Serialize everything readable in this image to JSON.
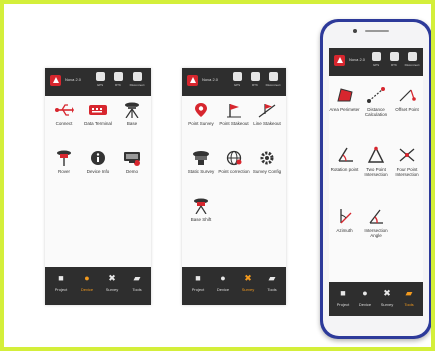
{
  "app": {
    "name": "Nova 2.0"
  },
  "topbar": {
    "icons": [
      {
        "name": "gps-status-icon",
        "label": "GPS"
      },
      {
        "name": "antenna-status-icon",
        "label": "RTK"
      },
      {
        "name": "disconnect-icon",
        "label": "Disconnect"
      }
    ]
  },
  "screens": {
    "project": {
      "items": [
        {
          "label": "Connect",
          "icon": "usb-icon"
        },
        {
          "label": "Data Terminal",
          "icon": "data-terminal-icon"
        },
        {
          "label": "Base",
          "icon": "base-station-icon"
        },
        {
          "label": "Rover",
          "icon": "rover-icon"
        },
        {
          "label": "Device Info",
          "icon": "info-icon"
        },
        {
          "label": "Demo",
          "icon": "demo-icon"
        }
      ],
      "active_tab": "Device"
    },
    "survey": {
      "items": [
        {
          "label": "Point Survey",
          "icon": "point-survey-icon"
        },
        {
          "label": "Point Stakeout",
          "icon": "point-stakeout-icon"
        },
        {
          "label": "Line Stakeout",
          "icon": "line-stakeout-icon"
        },
        {
          "label": "Static Survey",
          "icon": "static-survey-icon"
        },
        {
          "label": "Point correction",
          "icon": "point-correction-icon"
        },
        {
          "label": "Survey Config",
          "icon": "survey-config-icon"
        },
        {
          "label": "Base Shift",
          "icon": "base-shift-icon"
        }
      ],
      "active_tab": "Survey"
    },
    "tools": {
      "items": [
        {
          "label": "Area Perimeter",
          "icon": "area-perimeter-icon"
        },
        {
          "label": "Distance Calculation",
          "icon": "distance-calculation-icon"
        },
        {
          "label": "Offset Point",
          "icon": "offset-point-icon"
        },
        {
          "label": "Rotation point",
          "icon": "rotation-point-icon"
        },
        {
          "label": "Two Point Intersection",
          "icon": "two-point-intersection-icon"
        },
        {
          "label": "Four Point Intersection",
          "icon": "four-point-intersection-icon"
        },
        {
          "label": "Azimuth",
          "icon": "azimuth-icon"
        },
        {
          "label": "Intersection Angle",
          "icon": "intersection-angle-icon"
        }
      ],
      "active_tab": "Tools"
    }
  },
  "nav": [
    {
      "label": "Project",
      "icon": "folder-icon"
    },
    {
      "label": "Device",
      "icon": "location-pin-icon"
    },
    {
      "label": "Survey",
      "icon": "survey-cross-icon"
    },
    {
      "label": "Tools",
      "icon": "toolbox-icon"
    }
  ],
  "colors": {
    "accent": "#d7262e",
    "active": "#f39a1e",
    "bar": "#2e2e2e",
    "phone": "#2d3a9a",
    "frame": "#d4ef3a"
  }
}
